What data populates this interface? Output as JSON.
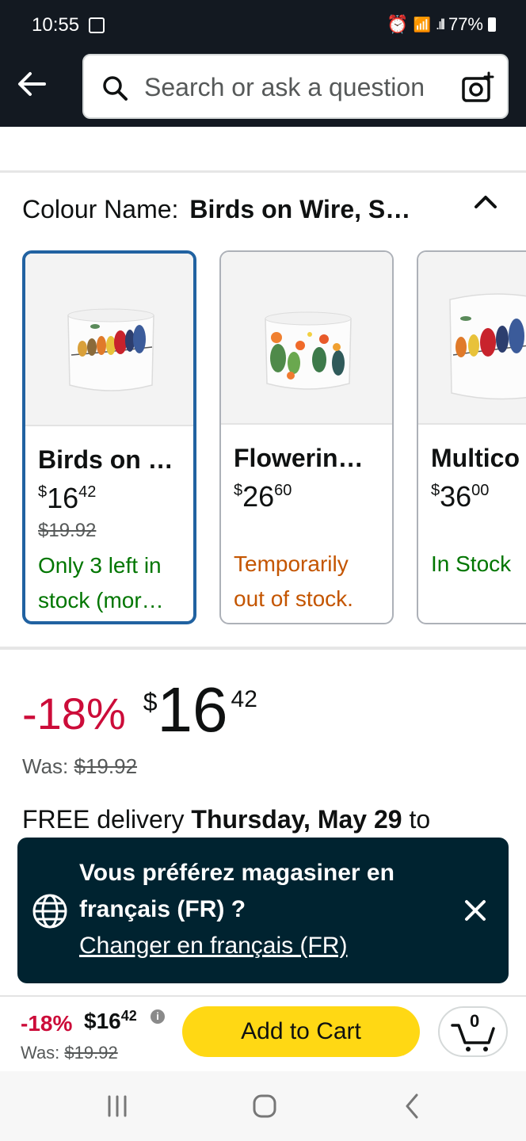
{
  "status_bar": {
    "time": "10:55",
    "battery": "77%"
  },
  "search": {
    "placeholder": "Search or ask a question"
  },
  "colour": {
    "label": "Colour Name:",
    "value": "Birds on Wire, S…"
  },
  "variants": [
    {
      "name": "Birds on …",
      "price_currency": "$",
      "price_whole": "16",
      "price_fraction": "42",
      "was": "$19.92",
      "stock": "Only 3 left in stock (mor…",
      "stock_color": "#007600",
      "selected": true
    },
    {
      "name": "Flowerin…",
      "price_currency": "$",
      "price_whole": "26",
      "price_fraction": "60",
      "was": "",
      "stock": "Temporarily out of stock.",
      "stock_color": "#c45500",
      "selected": false
    },
    {
      "name": "Multico",
      "price_currency": "$",
      "price_whole": "36",
      "price_fraction": "00",
      "was": "",
      "stock": "In Stock",
      "stock_color": "#007600",
      "selected": false
    }
  ],
  "price": {
    "discount": "-18%",
    "currency": "$",
    "whole": "16",
    "fraction": "42",
    "was_label": "Was:",
    "was_value": "$19.92"
  },
  "delivery": {
    "prefix": "FREE delivery",
    "date": "Thursday, May 29",
    "suffix": "to"
  },
  "language_banner": {
    "line1": "Vous préférez magasiner en",
    "line2": "français (FR) ?",
    "link": "Changer en français (FR)"
  },
  "buy_bar": {
    "discount": "-18%",
    "price_whole": "$16",
    "price_fraction": "42",
    "was_label": "Was:",
    "was_value": "$19.92",
    "add_to_cart": "Add to Cart",
    "cart_count": "0"
  },
  "colors": {
    "header_bg": "#131921",
    "accent_red": "#cc0c39",
    "button_yellow": "#ffd814",
    "selected_border": "#2162a1",
    "banner_bg": "#002330"
  }
}
